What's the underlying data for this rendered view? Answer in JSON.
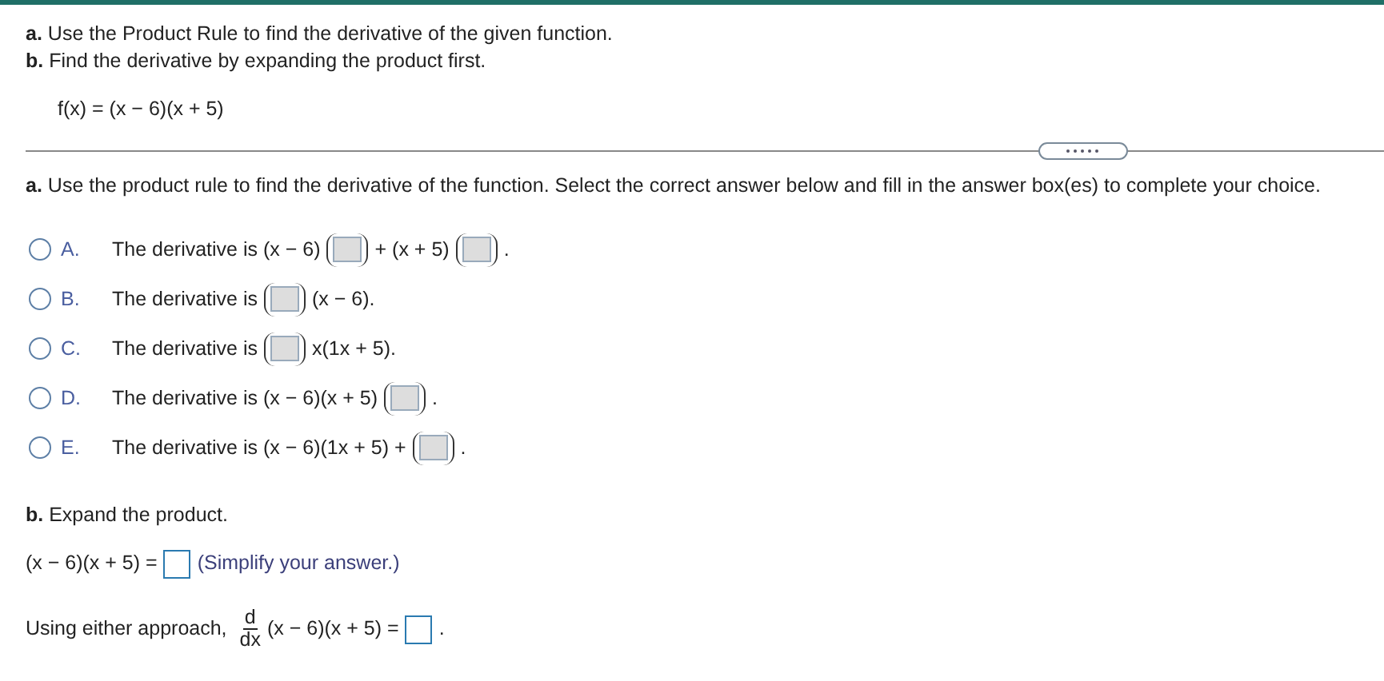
{
  "intro": [
    "**a.** Use the Product Rule to find the derivative of the given function.",
    "**b.** Find the derivative by expanding the product first."
  ],
  "function": "f(x) = (x − 6)(x + 5)",
  "part_a": {
    "prompt": "**a.** Use the product rule to find the derivative of the function. Select the correct answer below and fill in the answer box(es) to complete your choice.",
    "choices": [
      {
        "letter": "A.",
        "selected": false,
        "parts": [
          {
            "kind": "text",
            "text": "The derivative is (x − 6)"
          },
          {
            "kind": "paren_box"
          },
          {
            "kind": "text",
            "text": "+ (x + 5)"
          },
          {
            "kind": "paren_box"
          },
          {
            "kind": "text",
            "text": "."
          }
        ]
      },
      {
        "letter": "B.",
        "selected": false,
        "parts": [
          {
            "kind": "text",
            "text": "The derivative is"
          },
          {
            "kind": "paren_box"
          },
          {
            "kind": "text",
            "text": "(x − 6)."
          }
        ]
      },
      {
        "letter": "C.",
        "selected": false,
        "parts": [
          {
            "kind": "text",
            "text": "The derivative is"
          },
          {
            "kind": "paren_box"
          },
          {
            "kind": "text",
            "text": "x(1x + 5)."
          }
        ]
      },
      {
        "letter": "D.",
        "selected": false,
        "parts": [
          {
            "kind": "text",
            "text": "The derivative is (x − 6)(x + 5)"
          },
          {
            "kind": "paren_box"
          },
          {
            "kind": "text",
            "text": "."
          }
        ]
      },
      {
        "letter": "E.",
        "selected": false,
        "parts": [
          {
            "kind": "text",
            "text": "The derivative is (x − 6)(1x + 5) +"
          },
          {
            "kind": "paren_box"
          },
          {
            "kind": "text",
            "text": "."
          }
        ]
      }
    ]
  },
  "part_b": {
    "prompt": "**b.** Expand the product.",
    "lines": [
      {
        "parts": [
          {
            "kind": "text",
            "text": "(x − 6)(x + 5) ="
          },
          {
            "kind": "box"
          },
          {
            "kind": "hint",
            "text": "(Simplify your answer.)"
          }
        ]
      },
      {
        "parts": [
          {
            "kind": "text",
            "text": "Using either approach,"
          },
          {
            "kind": "fraction",
            "numerator": "d",
            "denominator": "dx"
          },
          {
            "kind": "text",
            "text": "(x − 6)(x + 5) ="
          },
          {
            "kind": "box"
          },
          {
            "kind": "text",
            "text": "."
          }
        ]
      }
    ]
  }
}
